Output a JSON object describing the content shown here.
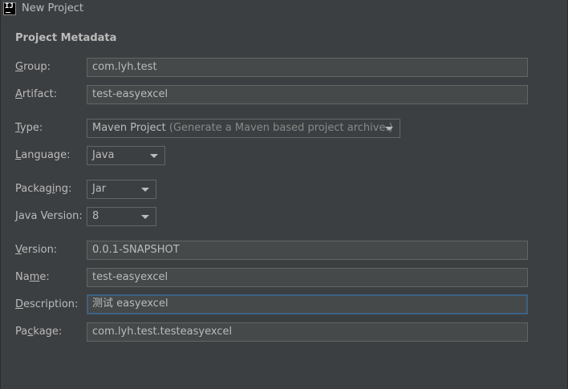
{
  "window": {
    "title": "New Project",
    "icon_text": "IJ"
  },
  "section": {
    "title": "Project Metadata"
  },
  "form": {
    "group": {
      "label_mn": "G",
      "label_rest": "roup:",
      "value": "com.lyh.test"
    },
    "artifact": {
      "label_mn": "A",
      "label_rest": "rtifact:",
      "value": "test-easyexcel"
    },
    "type": {
      "label_mn": "T",
      "label_rest": "ype:",
      "value": "Maven Project",
      "hint": "(Generate a Maven based project archive.)"
    },
    "language": {
      "label_mn": "L",
      "label_rest": "anguage:",
      "value": "Java"
    },
    "packaging": {
      "label_pre": "Packag",
      "label_mn": "i",
      "label_rest": "ng:",
      "value": "Jar"
    },
    "java_version": {
      "label_mn": "J",
      "label_rest": "ava Version:",
      "value": "8"
    },
    "version": {
      "label_mn": "V",
      "label_rest": "ersion:",
      "value": "0.0.1-SNAPSHOT"
    },
    "name": {
      "label_pre": "Na",
      "label_mn": "m",
      "label_rest": "e:",
      "value": "test-easyexcel"
    },
    "description": {
      "label_mn": "D",
      "label_rest": "escription:",
      "value": "测试 easyexcel"
    },
    "package": {
      "label_pre": "Pa",
      "label_mn": "c",
      "label_rest": "kage:",
      "value": "com.lyh.test.testeasyexcel"
    }
  },
  "colors": {
    "background": "#3c3f41",
    "field_bg": "#45494a",
    "field_border": "#646464",
    "focus_border": "#3d6185",
    "text": "#bbbbbb",
    "hint": "#888888"
  }
}
